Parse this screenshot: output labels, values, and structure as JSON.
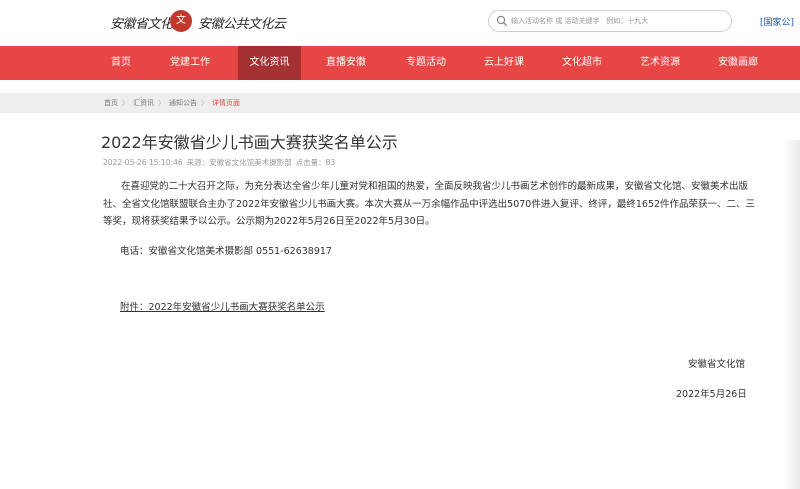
{
  "header": {
    "logo_left": "安徽省文化馆",
    "logo_mark": "文",
    "logo_right": "安徽公共文化云",
    "search_placeholder": "输入活动名称 或 活动关键字   例如：十九大",
    "nation_link": "[国家公]"
  },
  "nav": {
    "items": [
      {
        "label": "首页"
      },
      {
        "label": "党建工作"
      },
      {
        "label": "文化资讯",
        "active": true
      },
      {
        "label": "直播安徽"
      },
      {
        "label": "专题活动"
      },
      {
        "label": "云上好课"
      },
      {
        "label": "文化超市"
      },
      {
        "label": "艺术资源"
      },
      {
        "label": "安徽画廊"
      }
    ]
  },
  "breadcrumb": {
    "items": [
      "首页",
      "汇资讯",
      "通知公告",
      "详情页面"
    ],
    "separator": "〉"
  },
  "article": {
    "title": "2022年安徽省少儿书画大赛获奖名单公示",
    "date": "2022-05-26 15:10:46",
    "source": "来源：安徽省文化馆美术摄影部",
    "clicks": "点击量：83",
    "paragraph": "在喜迎党的二十大召开之际，为充分表达全省少年儿童对党和祖国的热爱，全面反映我省少儿书画艺术创作的最新成果，安徽省文化馆、安徽美术出版社、全省文化馆联盟联合主办了2022年安徽省少儿书画大赛。本次大赛从一万余幅作品中评选出5070件进入复评、终评，最终1652件作品荣获一、二、三等奖，现将获奖结果予以公示。公示期为2022年5月26日至2022年5月30日。",
    "contact": "电话：安徽省文化馆美术摄影部  0551-62638917",
    "attachment": "附件：2022年安徽省少儿书画大赛获奖名单公示",
    "signer": "安徽省文化馆",
    "sign_date": "2022年5月26日"
  },
  "colors": {
    "nav_bg": "#e84545",
    "nav_active": "#a53232",
    "breadcrumb_current": "#e84545"
  }
}
